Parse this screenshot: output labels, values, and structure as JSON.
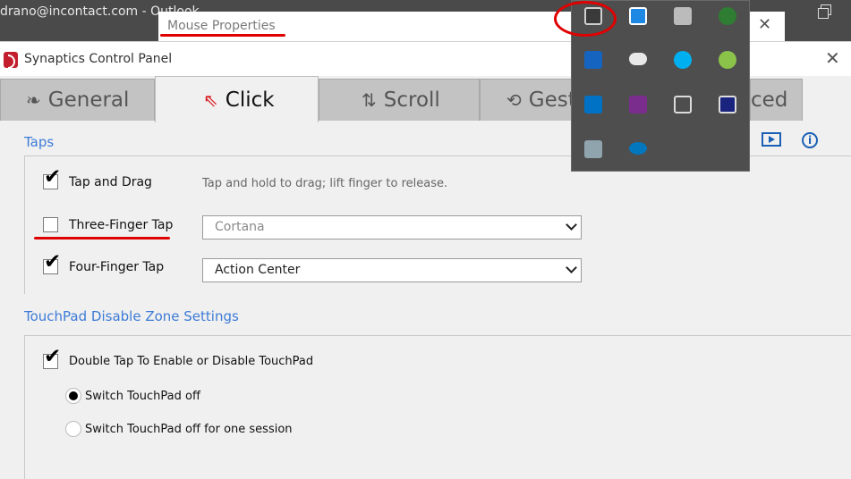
{
  "background_window": {
    "title": "drano@incontact.com - Outlook"
  },
  "mouse_properties": {
    "title": "Mouse Properties"
  },
  "synaptics": {
    "title": "Synaptics Control Panel",
    "tabs": [
      {
        "label": "General",
        "icon": "leaf-icon"
      },
      {
        "label": "Click",
        "icon": "cursor-click-icon"
      },
      {
        "label": "Scroll",
        "icon": "scroll-arrows-icon"
      },
      {
        "label": "Gest",
        "icon": "gesture-icon"
      },
      {
        "label": "ced",
        "icon": "advanced-icon"
      }
    ],
    "taps": {
      "heading": "Taps",
      "tap_drag": {
        "label": "Tap and Drag",
        "checked": true,
        "hint": "Tap and hold to drag; lift finger to release."
      },
      "three_finger": {
        "label": "Three-Finger Tap",
        "checked": false,
        "value": "Cortana"
      },
      "four_finger": {
        "label": "Four-Finger Tap",
        "checked": true,
        "value": "Action Center"
      }
    },
    "disable_zone": {
      "heading": "TouchPad Disable Zone Settings",
      "double_tap": {
        "label": "Double Tap To Enable or Disable TouchPad",
        "checked": true
      },
      "options": [
        {
          "label": "Switch TouchPad off",
          "selected": true
        },
        {
          "label": "Switch TouchPad off for one session",
          "selected": false
        }
      ]
    }
  },
  "annotation_color": "#e00000",
  "accent_color": "#3d7bd6",
  "tray_icons": [
    "touchpad-icon",
    "intel-graphics-icon",
    "network-monitor-icon",
    "globe-icon",
    "html5-shield-icon",
    "onedrive-cloud-icon",
    "skype-icon",
    "notification-icon",
    "outlook-icon",
    "onenote-icon",
    "document-icon",
    "usb-eject-icon",
    "storage-icon",
    "intel-icon"
  ]
}
